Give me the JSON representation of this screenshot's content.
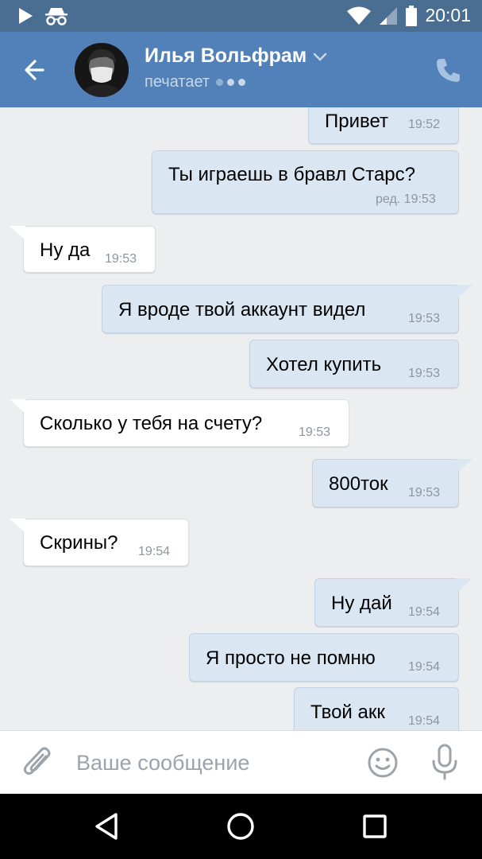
{
  "status_bar": {
    "time": "20:01",
    "icons": [
      "play-icon",
      "incognito-icon",
      "wifi-icon",
      "signal-icon",
      "battery-icon"
    ]
  },
  "header": {
    "contact_name": "Илья Вольфрам",
    "status": "печатает",
    "icons": [
      "back-arrow-icon",
      "chevron-down-icon",
      "phone-icon"
    ]
  },
  "messages": [
    {
      "dir": "out",
      "text": "Привет",
      "time": "19:52"
    },
    {
      "dir": "out",
      "text": "Ты играешь в бравл Старс?",
      "time": "ред. 19:53"
    },
    {
      "dir": "in",
      "text": "Ну да",
      "time": "19:53"
    },
    {
      "dir": "out",
      "text": "Я вроде твой аккаунт видел",
      "time": "19:53"
    },
    {
      "dir": "out",
      "text": "Хотел купить",
      "time": "19:53"
    },
    {
      "dir": "in",
      "text": "Сколько у тебя на счету?",
      "time": "19:53"
    },
    {
      "dir": "out",
      "text": "800ток",
      "time": "19:53"
    },
    {
      "dir": "in",
      "text": "Скрины?",
      "time": "19:54"
    },
    {
      "dir": "out",
      "text": "Ну дай",
      "time": "19:54"
    },
    {
      "dir": "out",
      "text": "Я просто не помню",
      "time": "19:54"
    },
    {
      "dir": "out",
      "text": "Твой акк",
      "time": "19:54"
    }
  ],
  "composer": {
    "placeholder": "Ваше сообщение",
    "icons": [
      "paperclip-icon",
      "emoji-icon",
      "microphone-icon"
    ]
  },
  "nav_bar": {
    "icons": [
      "back-triangle-icon",
      "home-circle-icon",
      "recents-square-icon"
    ]
  },
  "colors": {
    "header": "#5181b8",
    "status_bar": "#4a6d92",
    "chat_background": "#edeef0",
    "outgoing_bubble": "#dbe6f3",
    "incoming_bubble": "#ffffff"
  }
}
